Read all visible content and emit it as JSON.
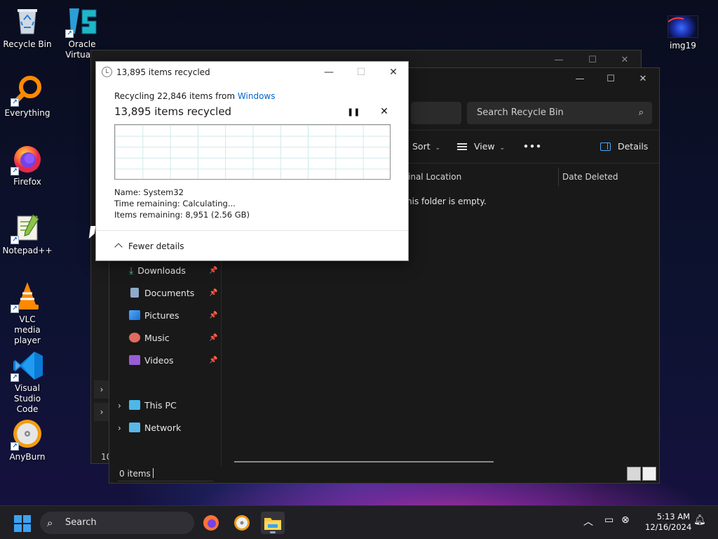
{
  "desktop": {
    "icons": [
      {
        "label": "Recycle Bin",
        "icon": "recycle-bin-icon"
      },
      {
        "label": "Oracle VirtualB",
        "icon": "virtualbox-icon"
      },
      {
        "label": "Everything",
        "icon": "everything-icon"
      },
      {
        "label": "Firefox",
        "icon": "firefox-icon"
      },
      {
        "label": "Notepad++",
        "icon": "notepadpp-icon"
      },
      {
        "label": "VLC media player",
        "icon": "vlc-icon"
      },
      {
        "label": "Visual Studio Code",
        "icon": "vscode-icon"
      },
      {
        "label": "AnyBurn",
        "icon": "anyburn-icon"
      },
      {
        "label": "img19",
        "icon": "image-file-icon"
      }
    ]
  },
  "explorer": {
    "search_placeholder": "Search Recycle Bin",
    "toolbar": {
      "sort": "Sort",
      "view": "View",
      "more": "•••",
      "details": "Details"
    },
    "columns": [
      "inal Location",
      "Date Deleted"
    ],
    "empty_message": "his folder is empty.",
    "nav": [
      {
        "label": "Downloads",
        "pinned": true
      },
      {
        "label": "Documents",
        "pinned": true
      },
      {
        "label": "Pictures",
        "pinned": true
      },
      {
        "label": "Music",
        "pinned": true
      },
      {
        "label": "Videos",
        "pinned": true
      },
      {
        "label": "This PC"
      },
      {
        "label": "Network"
      }
    ],
    "status": {
      "item_count": "0 items"
    },
    "back_window_status": "10"
  },
  "dialog": {
    "title": "13,895 items recycled",
    "line1_prefix": "Recycling 22,846 items from ",
    "line1_link": "Windows",
    "heading": "13,895 items recycled",
    "name": "Name:  System32",
    "time_remaining": "Time remaining:  Calculating...",
    "items_remaining": "Items remaining:  8,951 (2.56 GB)",
    "fewer_details": "Fewer details"
  },
  "taskbar": {
    "search": "Search",
    "time": "5:13 AM",
    "date": "12/16/2024"
  },
  "colors": {
    "accent": "#3aa3f5",
    "link": "#0066cc",
    "explorer_bg": "#191919",
    "taskbar_bg": "#1f1f24"
  }
}
